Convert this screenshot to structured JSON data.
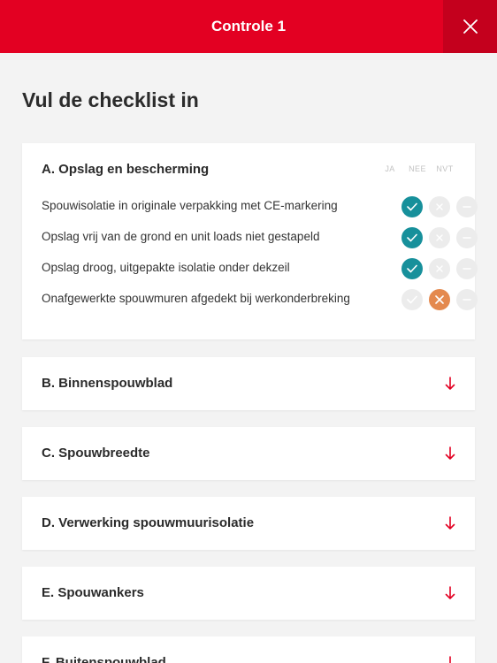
{
  "header": {
    "title": "Controle 1",
    "close_icon": "close-icon"
  },
  "page": {
    "title": "Vul de checklist in"
  },
  "columns": [
    "JA",
    "NEE",
    "NVT"
  ],
  "section_a": {
    "title": "A. Opslag en bescherming",
    "items": [
      {
        "label": "Spouwisolatie in originale verpakking met CE-markering",
        "selected": "JA"
      },
      {
        "label": "Opslag vrij van de grond en unit loads niet gestapeld",
        "selected": "JA"
      },
      {
        "label": "Opslag droog, uitgepakte isolatie onder dekzeil",
        "selected": "JA"
      },
      {
        "label": "Onafgewerkte spouwmuren afgedekt bij werkonderbreking",
        "selected": "NEE"
      }
    ]
  },
  "sections": [
    {
      "title": "B. Binnenspouwblad"
    },
    {
      "title": "C. Spouwbreedte"
    },
    {
      "title": "D. Verwerking spouwmuurisolatie"
    },
    {
      "title": "E. Spouwankers"
    },
    {
      "title": "F. Buitenspouwblad"
    }
  ],
  "colors": {
    "brand": "#e30022",
    "ja_selected": "#17909b",
    "nee_selected": "#e4894e",
    "unselected": "#ececec"
  }
}
